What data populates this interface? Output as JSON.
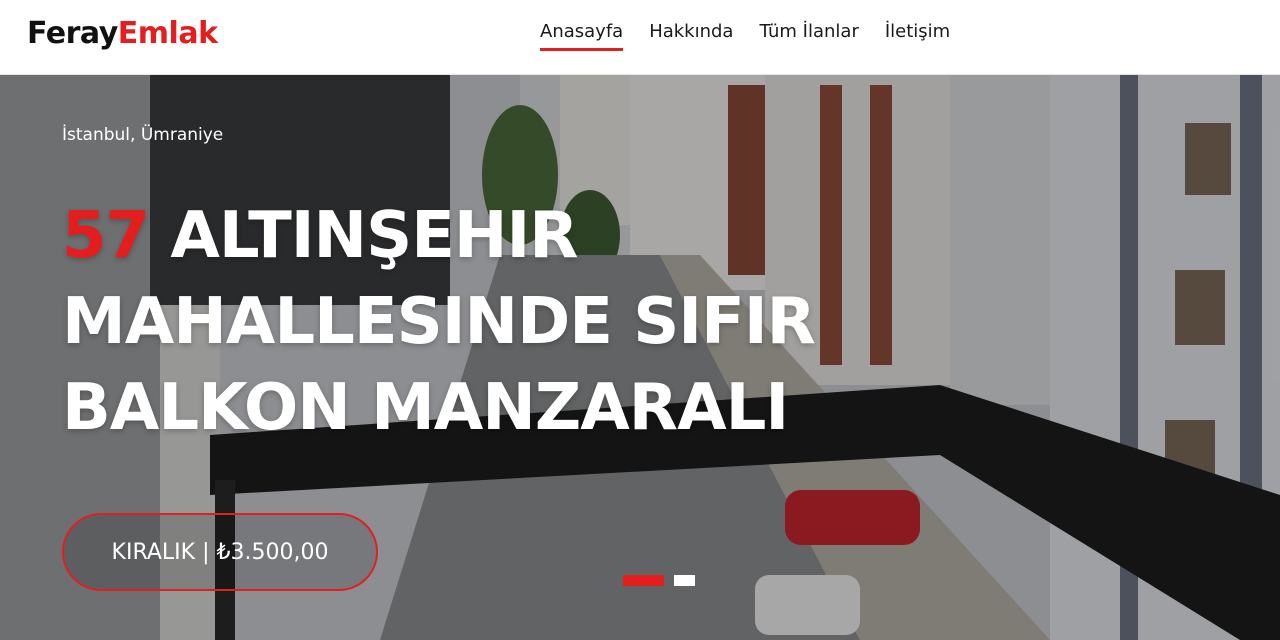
{
  "colors": {
    "accent": "#e41e1e",
    "header_bg": "#ffffff",
    "text_dark": "#111111"
  },
  "brand": {
    "part1": "Feray",
    "part2": "Emlak"
  },
  "nav": {
    "items": [
      {
        "label": "Anasayfa",
        "active": true
      },
      {
        "label": "Hakkında",
        "active": false
      },
      {
        "label": "Tüm İlanlar",
        "active": false
      },
      {
        "label": "İletişim",
        "active": false
      }
    ]
  },
  "hero": {
    "location": "İstanbul, Ümraniye",
    "title_number": "57",
    "title_text": " ALTINŞEHIR MAHALLESINDE SIFIR BALKON MANZARALI",
    "price": "KIRALIK | ₺3.500,00",
    "slides_total": 2,
    "active_slide": 1
  }
}
